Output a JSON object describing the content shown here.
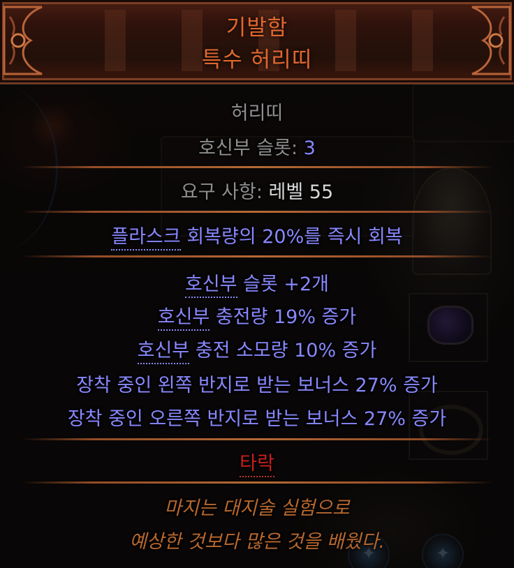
{
  "item": {
    "rarity_name": "기발함",
    "base_type": "특수 허리띠",
    "item_class": "허리띠",
    "charm_slots": {
      "label": "호신부 슬롯",
      "separator": ": ",
      "value": "3"
    },
    "requirements": {
      "label": "요구 사항",
      "separator": ": ",
      "level_label": "레벨",
      "level_value": "55"
    },
    "implicit": {
      "keyword": "플라스크",
      "rest": " 회복량의 20%를 즉시 회복"
    },
    "explicit_mods": [
      {
        "keyword": "호신부",
        "rest": " 슬롯 +2개"
      },
      {
        "keyword": "호신부",
        "rest": " 충전량 19% 증가"
      },
      {
        "keyword": "호신부",
        "rest": " 충전 소모량 10% 증가"
      },
      {
        "keyword": "",
        "rest": "장착 중인 왼쪽 반지로 받는 보너스 27% 증가"
      },
      {
        "keyword": "",
        "rest": "장착 중인 오른쪽 반지로 받는 보너스 27% 증가"
      }
    ],
    "corrupted_label": "타락",
    "flavour_text": [
      "마지는 대지술 실험으로",
      "예상한 것보다 많은 것을 배웠다."
    ]
  },
  "colors": {
    "title": "#e0672e",
    "magic_blue": "#8888ff",
    "corrupted_red": "#c82020",
    "flavour_gold": "#b8682e",
    "grey_text": "#8f8f8f",
    "value_text": "#d9d9d9"
  }
}
